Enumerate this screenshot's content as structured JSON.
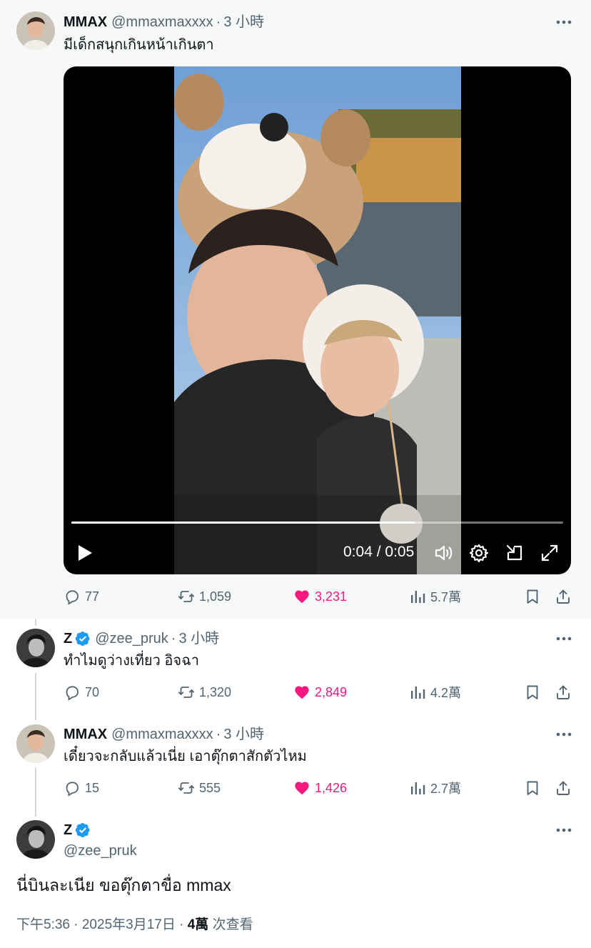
{
  "thread": {
    "tweet1": {
      "name": "MMAX",
      "handle": "@mmaxmaxxxx",
      "dot": "·",
      "time": "3 小時",
      "text": "มีเด็กสนุกเกินหน้าเกินตา",
      "video": {
        "current_time": "0:04",
        "separator": "/",
        "duration": "0:05",
        "progress": 0.7,
        "icons": [
          "play-icon",
          "volume-icon",
          "settings-icon",
          "minimize-icon",
          "fullscreen-icon"
        ]
      },
      "replies": "77",
      "reposts": "1,059",
      "likes": "3,231",
      "views": "5.7萬"
    },
    "tweet2": {
      "name": "Z",
      "handle": "@zee_pruk",
      "dot": "·",
      "time": "3 小時",
      "text": "ทำไมดูว่างเที่ยว อิจฉา",
      "replies": "70",
      "reposts": "1,320",
      "likes": "2,849",
      "views": "4.2萬"
    },
    "tweet3": {
      "name": "MMAX",
      "handle": "@mmaxmaxxxx",
      "dot": "·",
      "time": "3 小時",
      "text": "เดี๋ยวจะกลับแล้วเนี่ย เอาตุ๊กตาสักตัวไหม",
      "replies": "15",
      "reposts": "555",
      "likes": "1,426",
      "views": "2.7萬"
    },
    "focus": {
      "name": "Z",
      "handle": "@zee_pruk",
      "text": "นี่บินละเนีย ขอตุ๊กตาขื่อ mmax",
      "timestamp": "下午5:36 · 2025年3月17日 ·",
      "views_count": "4萬",
      "views_label": "次查看"
    }
  },
  "colors": {
    "like": "#f91880",
    "verified": "#1d9bf0",
    "secondary_text": "#536471",
    "thread_line": "#cfd9de"
  }
}
